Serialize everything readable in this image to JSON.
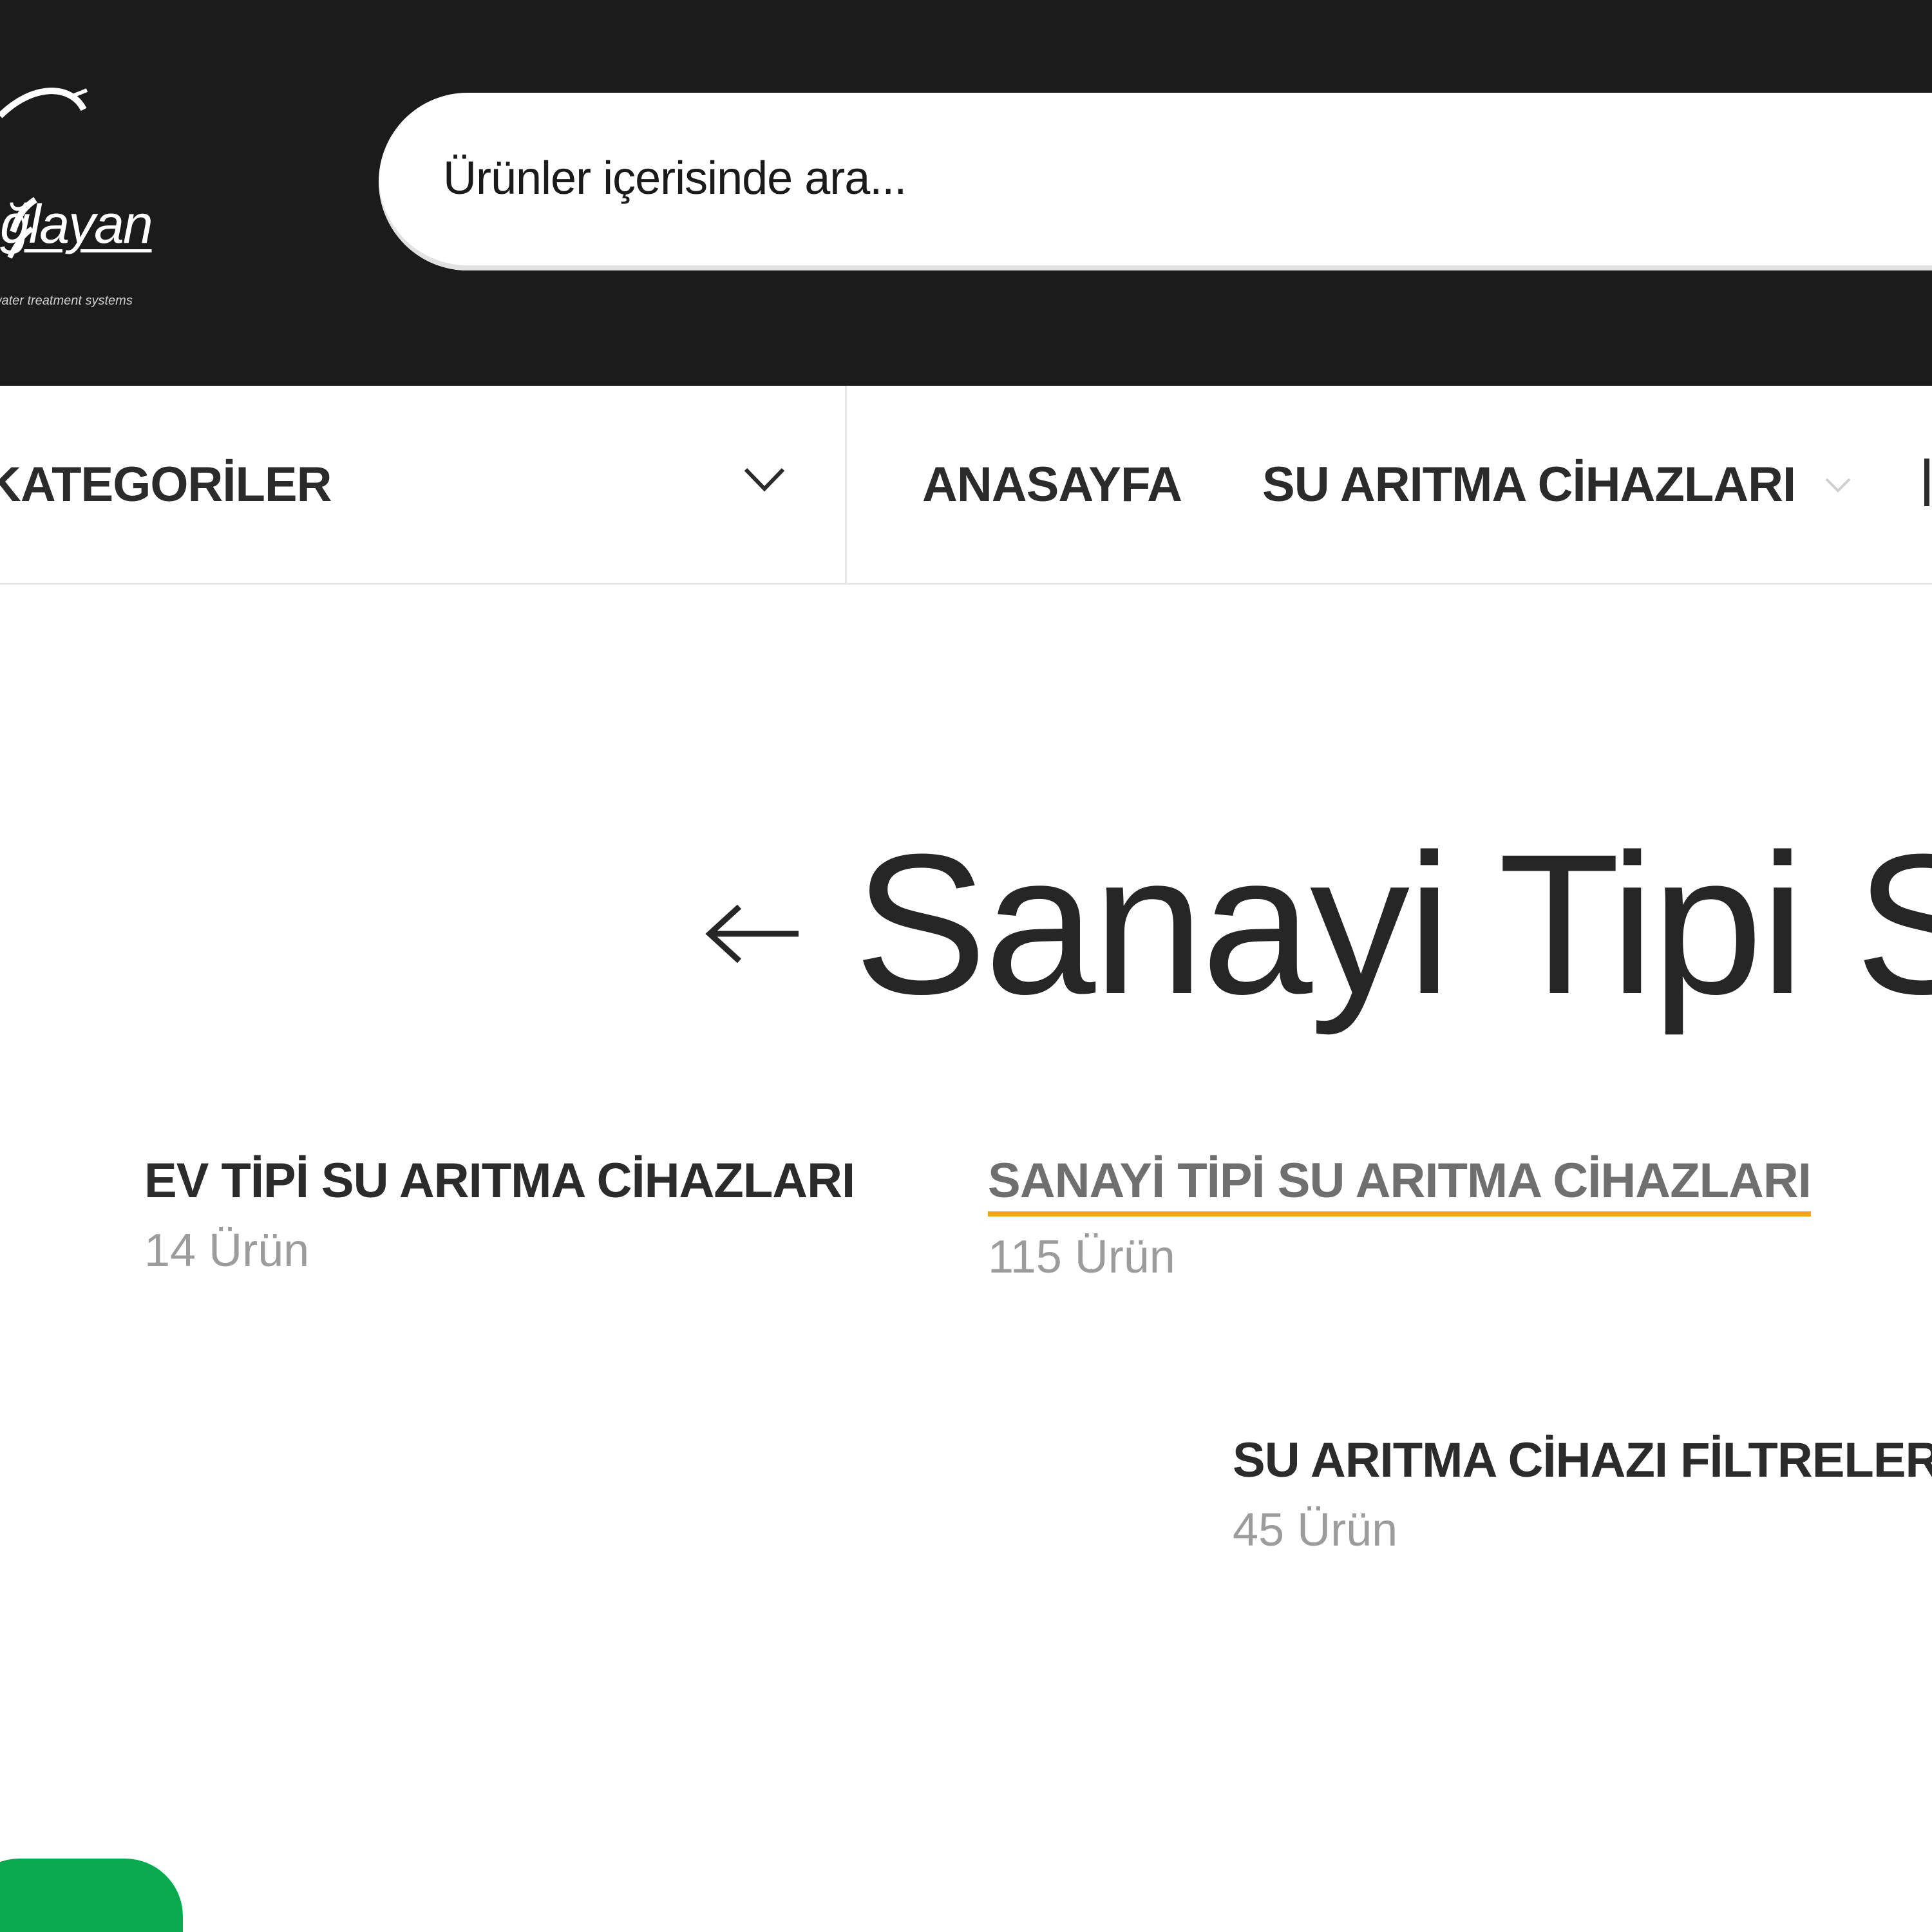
{
  "header": {
    "logo_text": "ğlayan",
    "logo_subtext": "water treatment systems",
    "search": {
      "placeholder": "Ürünler içerisinde ara..."
    }
  },
  "nav": {
    "categories_label": "KATEGORİLER",
    "items": [
      {
        "label": "ANASAYFA"
      },
      {
        "label": "SU ARITMA CİHAZLARI"
      }
    ]
  },
  "main": {
    "back_icon": "left-arrow-icon",
    "title": "Sanayi Tipi Su",
    "categories": [
      {
        "name": "EV TİPİ SU ARITMA CİHAZLARI",
        "count": "14 Ürün",
        "active": false
      },
      {
        "name": "SANAYİ TİPİ SU ARITMA CİHAZLARI",
        "count": "115 Ürün",
        "active": true
      },
      {
        "name": "SU ARITMA CİHAZI FİLTRELERİ",
        "count": "45 Ürün",
        "active": false
      }
    ]
  },
  "colors": {
    "header_bg": "#1b1b1b",
    "accent_underline": "#f2a51c",
    "whatsapp_green": "#0aa84f",
    "count_gray": "#9c9c9c"
  }
}
